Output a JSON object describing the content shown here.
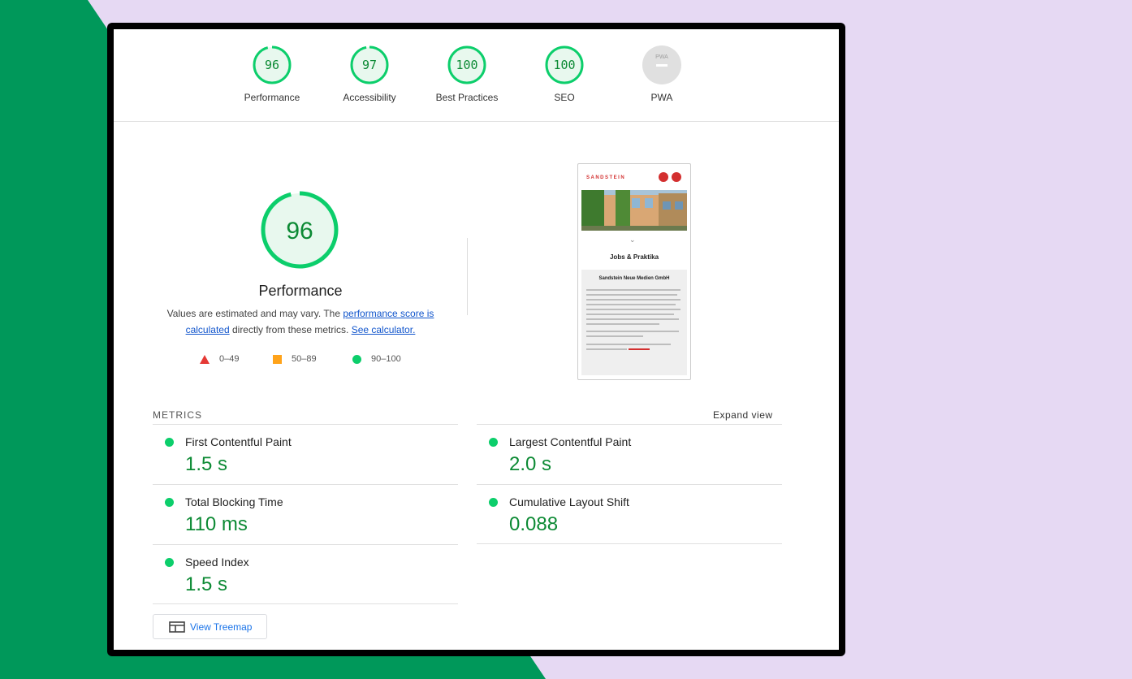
{
  "colors": {
    "pass": "#0cce6b",
    "pass_text": "#0c8a34",
    "average": "#ffa31a",
    "fail": "#e53935",
    "link": "#1155cc"
  },
  "categories": [
    {
      "label": "Performance",
      "score": "96",
      "fraction": 0.96
    },
    {
      "label": "Accessibility",
      "score": "97",
      "fraction": 0.97
    },
    {
      "label": "Best Practices",
      "score": "100",
      "fraction": 1.0
    },
    {
      "label": "SEO",
      "score": "100",
      "fraction": 1.0
    },
    {
      "label": "PWA",
      "score": "",
      "badge_text": "PWA"
    }
  ],
  "performance": {
    "score": "96",
    "fraction": 0.96,
    "title": "Performance",
    "desc_prefix": "Values are estimated and may vary. The ",
    "desc_link1": "performance score is calculated",
    "desc_middle": " directly from these metrics. ",
    "desc_link2": "See calculator."
  },
  "legend": [
    {
      "range": "0–49",
      "icon": "triangle-icon"
    },
    {
      "range": "50–89",
      "icon": "square-icon"
    },
    {
      "range": "90–100",
      "icon": "circle-icon"
    }
  ],
  "screenshot": {
    "brand": "SANDSTEIN",
    "heading": "Jobs & Praktika",
    "box_heading": "Sandstein Neue Medien GmbH"
  },
  "metrics": {
    "header": "METRICS",
    "expand": "Expand view",
    "items": [
      {
        "label": "First Contentful Paint",
        "value": "1.5 s"
      },
      {
        "label": "Largest Contentful Paint",
        "value": "2.0 s"
      },
      {
        "label": "Total Blocking Time",
        "value": "110 ms"
      },
      {
        "label": "Cumulative Layout Shift",
        "value": "0.088"
      },
      {
        "label": "Speed Index",
        "value": "1.5 s"
      }
    ]
  },
  "treemap_button": "View Treemap"
}
